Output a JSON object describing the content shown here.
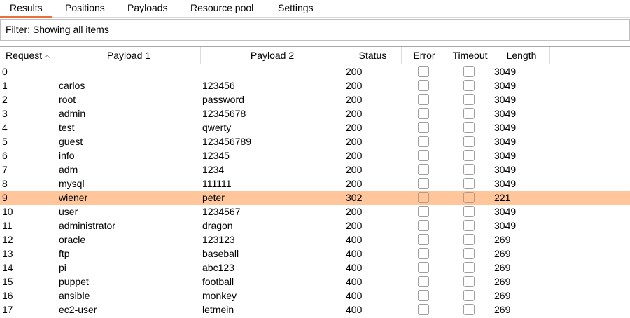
{
  "tabs": [
    {
      "label": "Results",
      "active": true
    },
    {
      "label": "Positions",
      "active": false
    },
    {
      "label": "Payloads",
      "active": false
    },
    {
      "label": "Resource pool",
      "active": false
    },
    {
      "label": "Settings",
      "active": false
    }
  ],
  "filter": {
    "text": "Filter: Showing all items"
  },
  "columns": {
    "request": "Request",
    "payload1": "Payload 1",
    "payload2": "Payload 2",
    "status": "Status",
    "error": "Error",
    "timeout": "Timeout",
    "length": "Length"
  },
  "sort_icon": "sort-ascending-icon",
  "highlight_color": "#ffc59b",
  "accent_color": "#e8703a",
  "rows": [
    {
      "request": "0",
      "payload1": "",
      "payload2": "",
      "status": "200",
      "length": "3049",
      "highlighted": false
    },
    {
      "request": "1",
      "payload1": "carlos",
      "payload2": "123456",
      "status": "200",
      "length": "3049",
      "highlighted": false
    },
    {
      "request": "2",
      "payload1": "root",
      "payload2": "password",
      "status": "200",
      "length": "3049",
      "highlighted": false
    },
    {
      "request": "3",
      "payload1": "admin",
      "payload2": "12345678",
      "status": "200",
      "length": "3049",
      "highlighted": false
    },
    {
      "request": "4",
      "payload1": "test",
      "payload2": "qwerty",
      "status": "200",
      "length": "3049",
      "highlighted": false
    },
    {
      "request": "5",
      "payload1": "guest",
      "payload2": "123456789",
      "status": "200",
      "length": "3049",
      "highlighted": false
    },
    {
      "request": "6",
      "payload1": "info",
      "payload2": "12345",
      "status": "200",
      "length": "3049",
      "highlighted": false
    },
    {
      "request": "7",
      "payload1": "adm",
      "payload2": "1234",
      "status": "200",
      "length": "3049",
      "highlighted": false
    },
    {
      "request": "8",
      "payload1": "mysql",
      "payload2": "111111",
      "status": "200",
      "length": "3049",
      "highlighted": false
    },
    {
      "request": "9",
      "payload1": "wiener",
      "payload2": "peter",
      "status": "302",
      "length": "221",
      "highlighted": true
    },
    {
      "request": "10",
      "payload1": "user",
      "payload2": "1234567",
      "status": "200",
      "length": "3049",
      "highlighted": false
    },
    {
      "request": "11",
      "payload1": "administrator",
      "payload2": "dragon",
      "status": "200",
      "length": "3049",
      "highlighted": false
    },
    {
      "request": "12",
      "payload1": "oracle",
      "payload2": "123123",
      "status": "400",
      "length": "269",
      "highlighted": false
    },
    {
      "request": "13",
      "payload1": "ftp",
      "payload2": "baseball",
      "status": "400",
      "length": "269",
      "highlighted": false
    },
    {
      "request": "14",
      "payload1": "pi",
      "payload2": "abc123",
      "status": "400",
      "length": "269",
      "highlighted": false
    },
    {
      "request": "15",
      "payload1": "puppet",
      "payload2": "football",
      "status": "400",
      "length": "269",
      "highlighted": false
    },
    {
      "request": "16",
      "payload1": "ansible",
      "payload2": "monkey",
      "status": "400",
      "length": "269",
      "highlighted": false
    },
    {
      "request": "17",
      "payload1": "ec2-user",
      "payload2": "letmein",
      "status": "400",
      "length": "269",
      "highlighted": false
    }
  ]
}
